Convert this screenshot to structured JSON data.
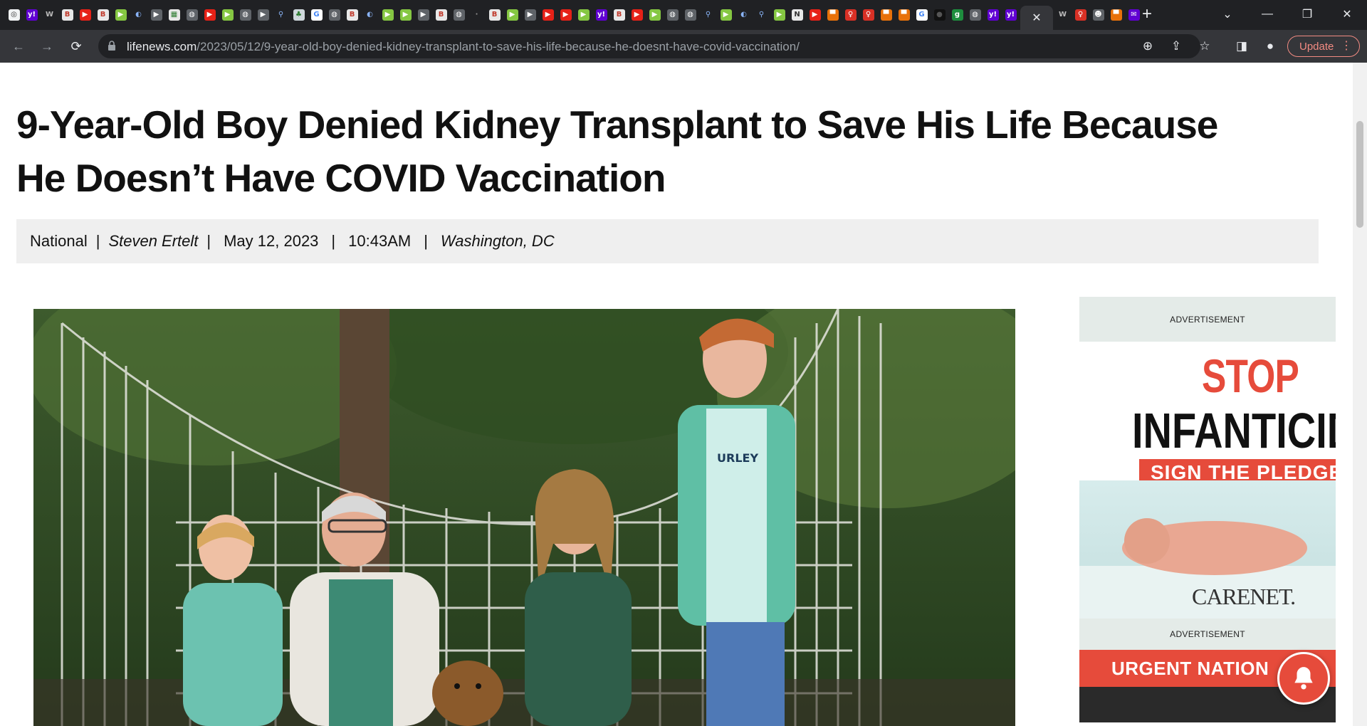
{
  "browser": {
    "tab_favicons": [
      {
        "name": "chrome",
        "bg": "#f1f3f4",
        "fg": "#333",
        "glyph": "◎"
      },
      {
        "name": "yahoo",
        "bg": "#6001d2",
        "fg": "#fff",
        "glyph": "y!"
      },
      {
        "name": "wiki",
        "bg": "#202124",
        "fg": "#bbb",
        "glyph": "W"
      },
      {
        "name": "breitbart",
        "bg": "#e8e8e8",
        "fg": "#c0392b",
        "glyph": "B"
      },
      {
        "name": "youtube",
        "bg": "#e62117",
        "fg": "#fff",
        "glyph": "▶"
      },
      {
        "name": "breitbart",
        "bg": "#e8e8e8",
        "fg": "#c0392b",
        "glyph": "B"
      },
      {
        "name": "rumble",
        "bg": "#85c742",
        "fg": "#fff",
        "glyph": "▶"
      },
      {
        "name": "shield",
        "bg": "#202124",
        "fg": "#8ab4f8",
        "glyph": "◐"
      },
      {
        "name": "generic",
        "bg": "#5f6368",
        "fg": "#fff",
        "glyph": "▶"
      },
      {
        "name": "pattern",
        "bg": "#e8e8e8",
        "fg": "#2e7d32",
        "glyph": "▦"
      },
      {
        "name": "globe",
        "bg": "#5f6368",
        "fg": "#fff",
        "glyph": "◍"
      },
      {
        "name": "youtube",
        "bg": "#e62117",
        "fg": "#fff",
        "glyph": "▶"
      },
      {
        "name": "rumble",
        "bg": "#85c742",
        "fg": "#fff",
        "glyph": "▶"
      },
      {
        "name": "globe",
        "bg": "#5f6368",
        "fg": "#fff",
        "glyph": "◍"
      },
      {
        "name": "generic",
        "bg": "#5f6368",
        "fg": "#fff",
        "glyph": "▶"
      },
      {
        "name": "search",
        "bg": "#202124",
        "fg": "#8ab4f8",
        "glyph": "⚲"
      },
      {
        "name": "tree",
        "bg": "#cfd8dc",
        "fg": "#2e7d32",
        "glyph": "♣"
      },
      {
        "name": "google",
        "bg": "#fff",
        "fg": "#4285f4",
        "glyph": "G"
      },
      {
        "name": "globe",
        "bg": "#5f6368",
        "fg": "#fff",
        "glyph": "◍"
      },
      {
        "name": "breitbart",
        "bg": "#e8e8e8",
        "fg": "#c0392b",
        "glyph": "B"
      },
      {
        "name": "shield",
        "bg": "#202124",
        "fg": "#8ab4f8",
        "glyph": "◐"
      },
      {
        "name": "rumble",
        "bg": "#85c742",
        "fg": "#fff",
        "glyph": "▶"
      },
      {
        "name": "rumble",
        "bg": "#85c742",
        "fg": "#fff",
        "glyph": "▶"
      },
      {
        "name": "generic",
        "bg": "#5f6368",
        "fg": "#fff",
        "glyph": "▶"
      },
      {
        "name": "breitbart",
        "bg": "#e8e8e8",
        "fg": "#c0392b",
        "glyph": "B"
      },
      {
        "name": "globe",
        "bg": "#5f6368",
        "fg": "#fff",
        "glyph": "◍"
      },
      {
        "name": "dark",
        "bg": "#202124",
        "fg": "#999",
        "glyph": "·"
      },
      {
        "name": "breitbart",
        "bg": "#e8e8e8",
        "fg": "#c0392b",
        "glyph": "B"
      },
      {
        "name": "rumble",
        "bg": "#85c742",
        "fg": "#fff",
        "glyph": "▶"
      },
      {
        "name": "generic",
        "bg": "#5f6368",
        "fg": "#fff",
        "glyph": "▶"
      },
      {
        "name": "youtube",
        "bg": "#e62117",
        "fg": "#fff",
        "glyph": "▶"
      },
      {
        "name": "youtube",
        "bg": "#e62117",
        "fg": "#fff",
        "glyph": "▶"
      },
      {
        "name": "rumble",
        "bg": "#85c742",
        "fg": "#fff",
        "glyph": "▶"
      },
      {
        "name": "yahoo",
        "bg": "#6001d2",
        "fg": "#fff",
        "glyph": "y!"
      },
      {
        "name": "breitbart",
        "bg": "#e8e8e8",
        "fg": "#c0392b",
        "glyph": "B"
      },
      {
        "name": "youtube",
        "bg": "#e62117",
        "fg": "#fff",
        "glyph": "▶"
      },
      {
        "name": "rumble",
        "bg": "#85c742",
        "fg": "#fff",
        "glyph": "▶"
      },
      {
        "name": "globe",
        "bg": "#5f6368",
        "fg": "#fff",
        "glyph": "◍"
      },
      {
        "name": "globe",
        "bg": "#5f6368",
        "fg": "#fff",
        "glyph": "◍"
      },
      {
        "name": "search",
        "bg": "#202124",
        "fg": "#8ab4f8",
        "glyph": "⚲"
      },
      {
        "name": "rumble",
        "bg": "#85c742",
        "fg": "#fff",
        "glyph": "▶"
      },
      {
        "name": "shield",
        "bg": "#202124",
        "fg": "#8ab4f8",
        "glyph": "◐"
      },
      {
        "name": "search",
        "bg": "#202124",
        "fg": "#8ab4f8",
        "glyph": "⚲"
      },
      {
        "name": "rumble",
        "bg": "#85c742",
        "fg": "#fff",
        "glyph": "▶"
      },
      {
        "name": "news",
        "bg": "#e8e8e8",
        "fg": "#333",
        "glyph": "N"
      },
      {
        "name": "youtube",
        "bg": "#e62117",
        "fg": "#fff",
        "glyph": "▶"
      },
      {
        "name": "bookmark",
        "bg": "#e8710a",
        "fg": "#fff",
        "glyph": "▀"
      },
      {
        "name": "pin",
        "bg": "#d93025",
        "fg": "#fff",
        "glyph": "♀"
      },
      {
        "name": "pin",
        "bg": "#d93025",
        "fg": "#fff",
        "glyph": "♀"
      },
      {
        "name": "bookmark",
        "bg": "#e8710a",
        "fg": "#fff",
        "glyph": "▀"
      },
      {
        "name": "bookmark",
        "bg": "#e8710a",
        "fg": "#fff",
        "glyph": "▀"
      },
      {
        "name": "google",
        "bg": "#fff",
        "fg": "#4285f4",
        "glyph": "G"
      },
      {
        "name": "circle",
        "bg": "#111",
        "fg": "#555",
        "glyph": "●"
      },
      {
        "name": "green",
        "bg": "#1e8e3e",
        "fg": "#fff",
        "glyph": "g"
      },
      {
        "name": "globe",
        "bg": "#5f6368",
        "fg": "#fff",
        "glyph": "◍"
      },
      {
        "name": "yahoo",
        "bg": "#6001d2",
        "fg": "#fff",
        "glyph": "y!"
      },
      {
        "name": "yahoo",
        "bg": "#6001d2",
        "fg": "#fff",
        "glyph": "y!"
      }
    ],
    "trailing_favicons": [
      {
        "name": "wiki",
        "bg": "#202124",
        "fg": "#bbb",
        "glyph": "W"
      },
      {
        "name": "pin",
        "bg": "#d93025",
        "fg": "#fff",
        "glyph": "♀"
      },
      {
        "name": "person",
        "bg": "#5f6368",
        "fg": "#fff",
        "glyph": "☻"
      },
      {
        "name": "bookmark",
        "bg": "#e8710a",
        "fg": "#fff",
        "glyph": "▀"
      },
      {
        "name": "mail",
        "bg": "#6001d2",
        "fg": "#fff",
        "glyph": "✉"
      }
    ],
    "url_host": "lifenews.com",
    "url_path": "/2023/05/12/9-year-old-boy-denied-kidney-transplant-to-save-his-life-because-he-doesnt-have-covid-vaccination/",
    "update_label": "Update"
  },
  "article": {
    "headline": "9-Year-Old Boy Denied Kidney Transplant to Save His Life Because He Doesn’t Have COVID Vaccination",
    "category": "National",
    "author": "Steven Ertelt",
    "date": "May 12, 2023",
    "time": "10:43AM",
    "location": "Washington, DC",
    "hero_shirt_text": "URLEY"
  },
  "sidebar": {
    "ad_label_1": "ADVERTISEMENT",
    "ad1_stop": "STOP",
    "ad1_infanticide": "INFANTICID",
    "ad1_pledge": "SIGN THE PLEDGE",
    "ad1_brand": "CARENET.",
    "ad_label_2": "ADVERTISEMENT",
    "ad2_urgent": "URGENT NATION"
  },
  "colors": {
    "chrome_dark": "#202124",
    "toolbar": "#35363a",
    "accent_red": "#e64b3b",
    "meta_bar": "#efefef"
  }
}
